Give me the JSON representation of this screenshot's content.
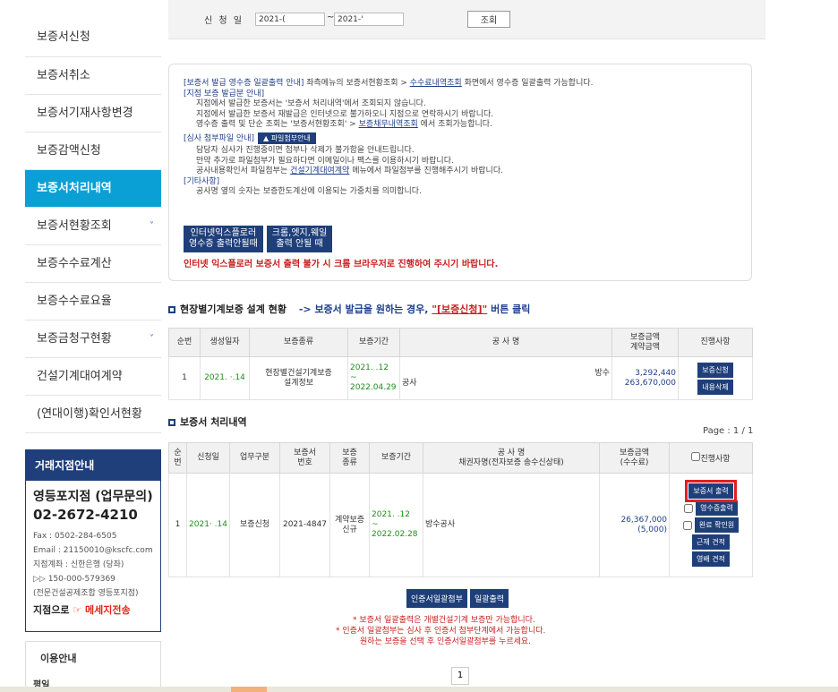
{
  "sidebar": {
    "items": [
      {
        "label": "보증서신청"
      },
      {
        "label": "보증서취소"
      },
      {
        "label": "보증서기재사항변경"
      },
      {
        "label": "보증감액신청"
      },
      {
        "label": "보증서처리내역"
      },
      {
        "label": "보증서현황조회"
      },
      {
        "label": "보증수수료계산"
      },
      {
        "label": "보증수수료요율"
      },
      {
        "label": "보증금청구현황"
      },
      {
        "label": "건설기계대여계약"
      },
      {
        "label": "(연대이행)확인서현황"
      }
    ],
    "chevron": "˅"
  },
  "branch": {
    "header": "거래지점안내",
    "title": "영등포지점 (업무문의)",
    "phone": "02-2672-4210",
    "fax": "Fax : 0502-284-6505",
    "email": "Email : 21150010@kscfc.com",
    "account": "지점계좌 : 신한은행 (당좌)",
    "account_no": "▷▷ 150-000-579369",
    "union": "(전문건설공제조합 영등포지점)",
    "send_prefix": "지점으로",
    "send_link": "☞ 메세지전송"
  },
  "guide": {
    "title": "이용안내",
    "sub": "평일"
  },
  "search": {
    "label": "신 청 일",
    "from": "2021-(",
    "tilde": "~",
    "to": "2021-'",
    "button": "조회"
  },
  "notice": {
    "l1_head": "[보증서 발급 영수증 일괄출력 안내]",
    "l1_mid": " 좌측메뉴의 보증서현황조회 > ",
    "l1_link": "수수료내역조회",
    "l1_tail": " 화면에서 영수증 일괄출력 가능합니다.",
    "l2": "[지점 보증 발급분 안내]",
    "l3": "지점에서 발급한 보증서는 '보증서 처리내역'에서 조회되지 않습니다.",
    "l4": "지점에서 발급한 보증서 재발급은 인터넷으로 불가하오니 지점으로 연락하시기 바랍니다.",
    "l5_pre": "영수증 출력 및 단순 조회는 '보증서현황조회' > ",
    "l5_link": "보증채무내역조회",
    "l5_tail": " 에서 조회가능합니다.",
    "l6": "[심사 첨부파일 안내]",
    "l6_btn": "▲ 파일첨부안내",
    "l7": "담당자 심사가 진행중이면 첨부나 삭제가 불가함을 안내드립니다.",
    "l8": "만약 추가로 파일첨부가 필요하다면 이메일이나 팩스를 이용하시기 바랍니다.",
    "l9_pre": "공사내용확인서 파일첨부는 ",
    "l9_link": "건설기계대여계약",
    "l9_tail": " 메뉴에서 파일첨부를 진행해주시기 바랍니다.",
    "l10": "[기타사항]",
    "l11": "공사명 옆의 숫자는 보증한도계산에 이용되는 가중치를 의미합니다.",
    "btn_ie_1": "인터넷익스플로러",
    "btn_ie_2": "영수증 출력안될때",
    "btn_chrome_1": "크롬,엣지,웨일",
    "btn_chrome_2": "출력 안될 때",
    "warning": "인터넷 익스플로러 보증서 출력 불가 시 크롬 브라우저로 진행하여 주시기 바랍니다."
  },
  "section1": {
    "title": "현장별기계보증 설계 현황",
    "arrow": "-> 보증서 발급을 원하는 경우, ",
    "link": "\"[보증신청]\"",
    "tail": " 버튼 클릭",
    "headers": [
      "순번",
      "생성일자",
      "보증종류",
      "보증기간",
      "공 사 명",
      "보증금액\n계약금액",
      "진행사항"
    ],
    "row": {
      "no": "1",
      "date": "2021.  ·.14",
      "type": "현장별건설기계보증\n설계정보",
      "period_1": "2021.  .12",
      "period_2": "~",
      "period_3": "2022.04.29",
      "name_1": "방수",
      "name_2": "공사",
      "amount_1": "3,292,440",
      "amount_2": "263,670,000",
      "btn_apply": "보증신청",
      "btn_delete": "내용삭제"
    }
  },
  "section2": {
    "title": "보증서 처리내역",
    "paging": "Page : 1 / 1",
    "headers": [
      "순\n번",
      "신청일",
      "업무구분",
      "보증서\n번호",
      "보증\n종류",
      "보증기간",
      "공 사 명\n채권자명(전자보증 송수신상태)",
      "보증금액\n(수수료)",
      "진행사항"
    ],
    "row": {
      "no": "1",
      "date": "2021·  .14",
      "biz": "보증신청",
      "cert_no": "2021-4847",
      "kind": "계약보증\n신규",
      "period_1": "2021.  .12",
      "period_2": "~",
      "period_3": "2022.02.28",
      "name": "방수공사",
      "amount": "26,367,000",
      "fee": "(5,000)",
      "btn_print": "보증서 출력",
      "btn_receipt": "영수증출력",
      "btn_confirm": "완료 확인원",
      "btn_estimate1": "근재 견적",
      "btn_estimate2": "영배 견적"
    }
  },
  "bottom": {
    "btn_attach": "인증서일괄첨부",
    "btn_print_all": "일괄출력",
    "note1": "* 보증서 일괄출력은 개별건설기계 보증만 가능합니다.",
    "note2": "* 인증서 일괄첨부는 심사 후 인증서 첨부단계에서 가능합니다.",
    "note3": "원하는 보증을 선택 후 인증서일괄첨부를 누르세요.",
    "page": "1"
  }
}
